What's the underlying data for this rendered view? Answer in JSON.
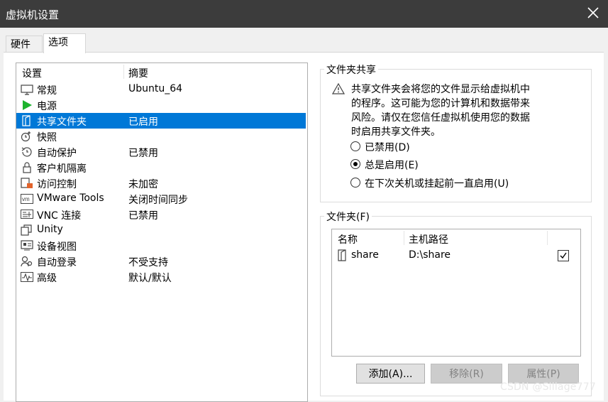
{
  "window": {
    "title": "虚拟机设置"
  },
  "tabs": [
    {
      "label": "硬件"
    },
    {
      "label": "选项"
    }
  ],
  "settings_list": {
    "headers": {
      "setting": "设置",
      "summary": "摘要"
    },
    "items": [
      {
        "label": "常规",
        "summary": "Ubuntu_64",
        "icon": "monitor-icon"
      },
      {
        "label": "电源",
        "summary": "",
        "icon": "power-play-icon"
      },
      {
        "label": "共享文件夹",
        "summary": "已启用",
        "icon": "shared-folder-icon"
      },
      {
        "label": "快照",
        "summary": "",
        "icon": "snapshot-icon"
      },
      {
        "label": "自动保护",
        "summary": "已禁用",
        "icon": "autoprotect-icon"
      },
      {
        "label": "客户机隔离",
        "summary": "",
        "icon": "lock-icon"
      },
      {
        "label": "访问控制",
        "summary": "未加密",
        "icon": "access-control-icon"
      },
      {
        "label": "VMware Tools",
        "summary": "关闭时间同步",
        "icon": "vm-icon"
      },
      {
        "label": "VNC 连接",
        "summary": "已禁用",
        "icon": "vnc-icon"
      },
      {
        "label": "Unity",
        "summary": "",
        "icon": "unity-icon"
      },
      {
        "label": "设备视图",
        "summary": "",
        "icon": "device-view-icon"
      },
      {
        "label": "自动登录",
        "summary": "不受支持",
        "icon": "autologin-icon"
      },
      {
        "label": "高级",
        "summary": "默认/默认",
        "icon": "advanced-icon"
      }
    ]
  },
  "folder_sharing": {
    "title": "文件夹共享",
    "warning_lines": [
      "共享文件夹会将您的文件显示给虚拟机中",
      "的程序。这可能为您的计算机和数据带来",
      "风险。请仅在您信任虚拟机使用您的数据",
      "时启用共享文件夹。"
    ],
    "options": [
      {
        "label": "已禁用(D)",
        "selected": false
      },
      {
        "label": "总是启用(E)",
        "selected": true
      },
      {
        "label": "在下次关机或挂起前一直启用(U)",
        "selected": false
      }
    ]
  },
  "folders": {
    "title": "文件夹(F)",
    "headers": {
      "name": "名称",
      "host_path": "主机路径"
    },
    "rows": [
      {
        "name": "share",
        "path": "D:\\share",
        "enabled": true
      }
    ],
    "buttons": {
      "add": "添加(A)...",
      "remove": "移除(R)",
      "properties": "属性(P)"
    }
  },
  "watermark": "CSDN @Sillage777",
  "colors": {
    "selection": "#0078d7",
    "titlebar": "#3c3c3c",
    "play": "#1db32d"
  }
}
